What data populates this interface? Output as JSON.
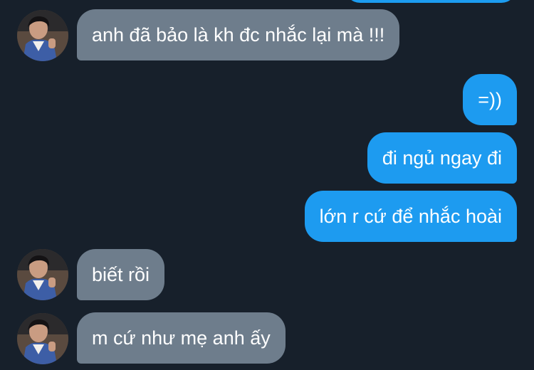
{
  "conversation": {
    "messages": [
      {
        "direction": "incoming",
        "text": "anh đã bảo là kh đc nhắc lại mà !!!",
        "has_avatar": true
      },
      {
        "direction": "outgoing",
        "text": "=))"
      },
      {
        "direction": "outgoing",
        "text": "đi ngủ ngay đi"
      },
      {
        "direction": "outgoing",
        "text": "lớn r cứ để nhắc hoài"
      },
      {
        "direction": "incoming",
        "text": "biết rồi",
        "has_avatar": true
      },
      {
        "direction": "incoming",
        "text": "m cứ như mẹ anh ấy",
        "has_avatar": true
      }
    ]
  },
  "colors": {
    "background": "#17202b",
    "incoming_bubble": "#6e7d8c",
    "outgoing_bubble": "#1d9bf0",
    "text": "#ffffff"
  }
}
